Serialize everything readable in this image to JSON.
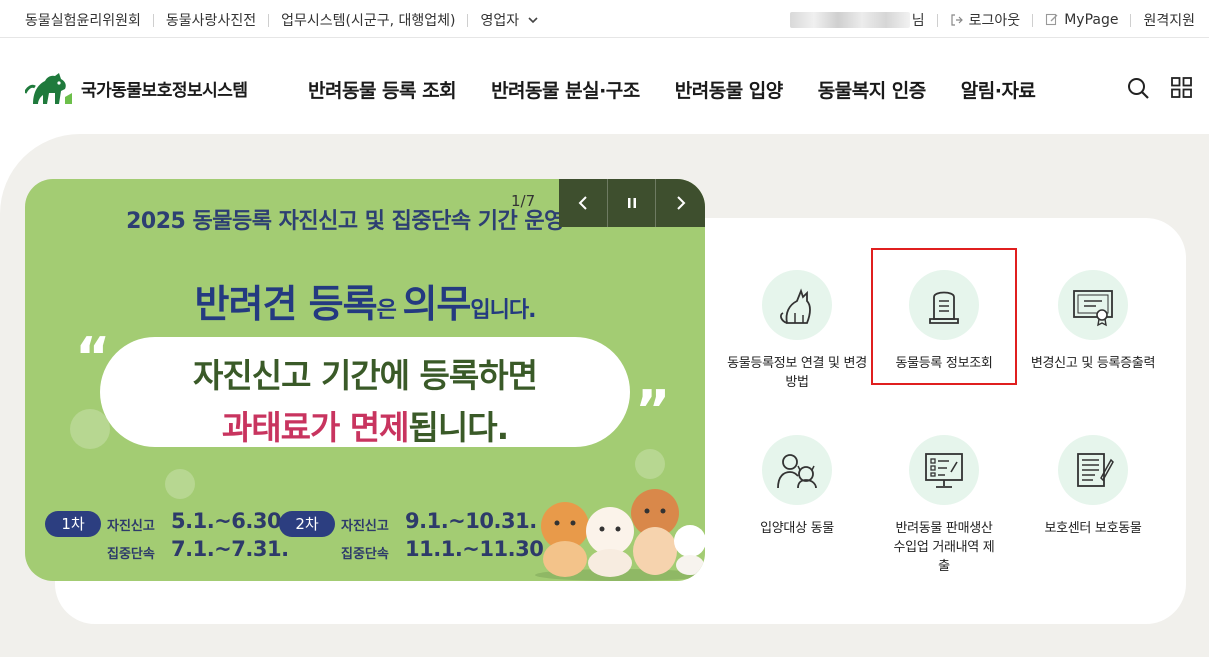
{
  "topbar": {
    "links": [
      "동물실험윤리위원회",
      "동물사랑사진전",
      "업무시스템(시군구, 대행업체)",
      "영업자"
    ],
    "user_suffix": "님",
    "logout": "로그아웃",
    "mypage": "MyPage",
    "remote": "원격지원"
  },
  "header": {
    "logo_title": "국가동물보호정보시스템",
    "nav": [
      "반려동물 등록 조회",
      "반려동물 분실·구조",
      "반려동물 입양",
      "동물복지 인증",
      "알림·자료"
    ]
  },
  "banner": {
    "headline": "2025 동물등록 자진신고 및 집중단속 기간 운영",
    "main_a": "반려견 등록",
    "main_b": "은 ",
    "main_c": "의무",
    "main_d": "입니다.",
    "bubble_line1": "자진신고 기간에 등록하면",
    "bubble_line2a": "과태료가 면제",
    "bubble_line2b": "됩니다.",
    "round1": "1차",
    "round2": "2차",
    "label_self": "자진신고",
    "label_crack": "집중단속",
    "r1_self": "5.1.~6.30.",
    "r1_crack": "7.1.~7.31.",
    "r2_self": "9.1.~10.31.",
    "r2_crack": "11.1.~11.30."
  },
  "slider": {
    "counter": "1/7"
  },
  "quick_menu": [
    {
      "label": "동물등록정보 연결 및 변경방법",
      "icon": "cat-icon"
    },
    {
      "label": "동물등록 정보조회",
      "icon": "tombstone-doc-icon"
    },
    {
      "label": "변경신고 및 등록증출력",
      "icon": "certificate-icon"
    },
    {
      "label": "입양대상 동물",
      "icon": "person-dog-icon"
    },
    {
      "label": "반려동물 판매생산수입업 거래내역 제출",
      "icon": "monitor-list-icon"
    },
    {
      "label": "보호센터 보호동물",
      "icon": "notepad-icon"
    }
  ],
  "colors": {
    "brand_green": "#1f7a3c",
    "banner_bg": "#a3cc73",
    "highlight": "#e01f1f"
  }
}
